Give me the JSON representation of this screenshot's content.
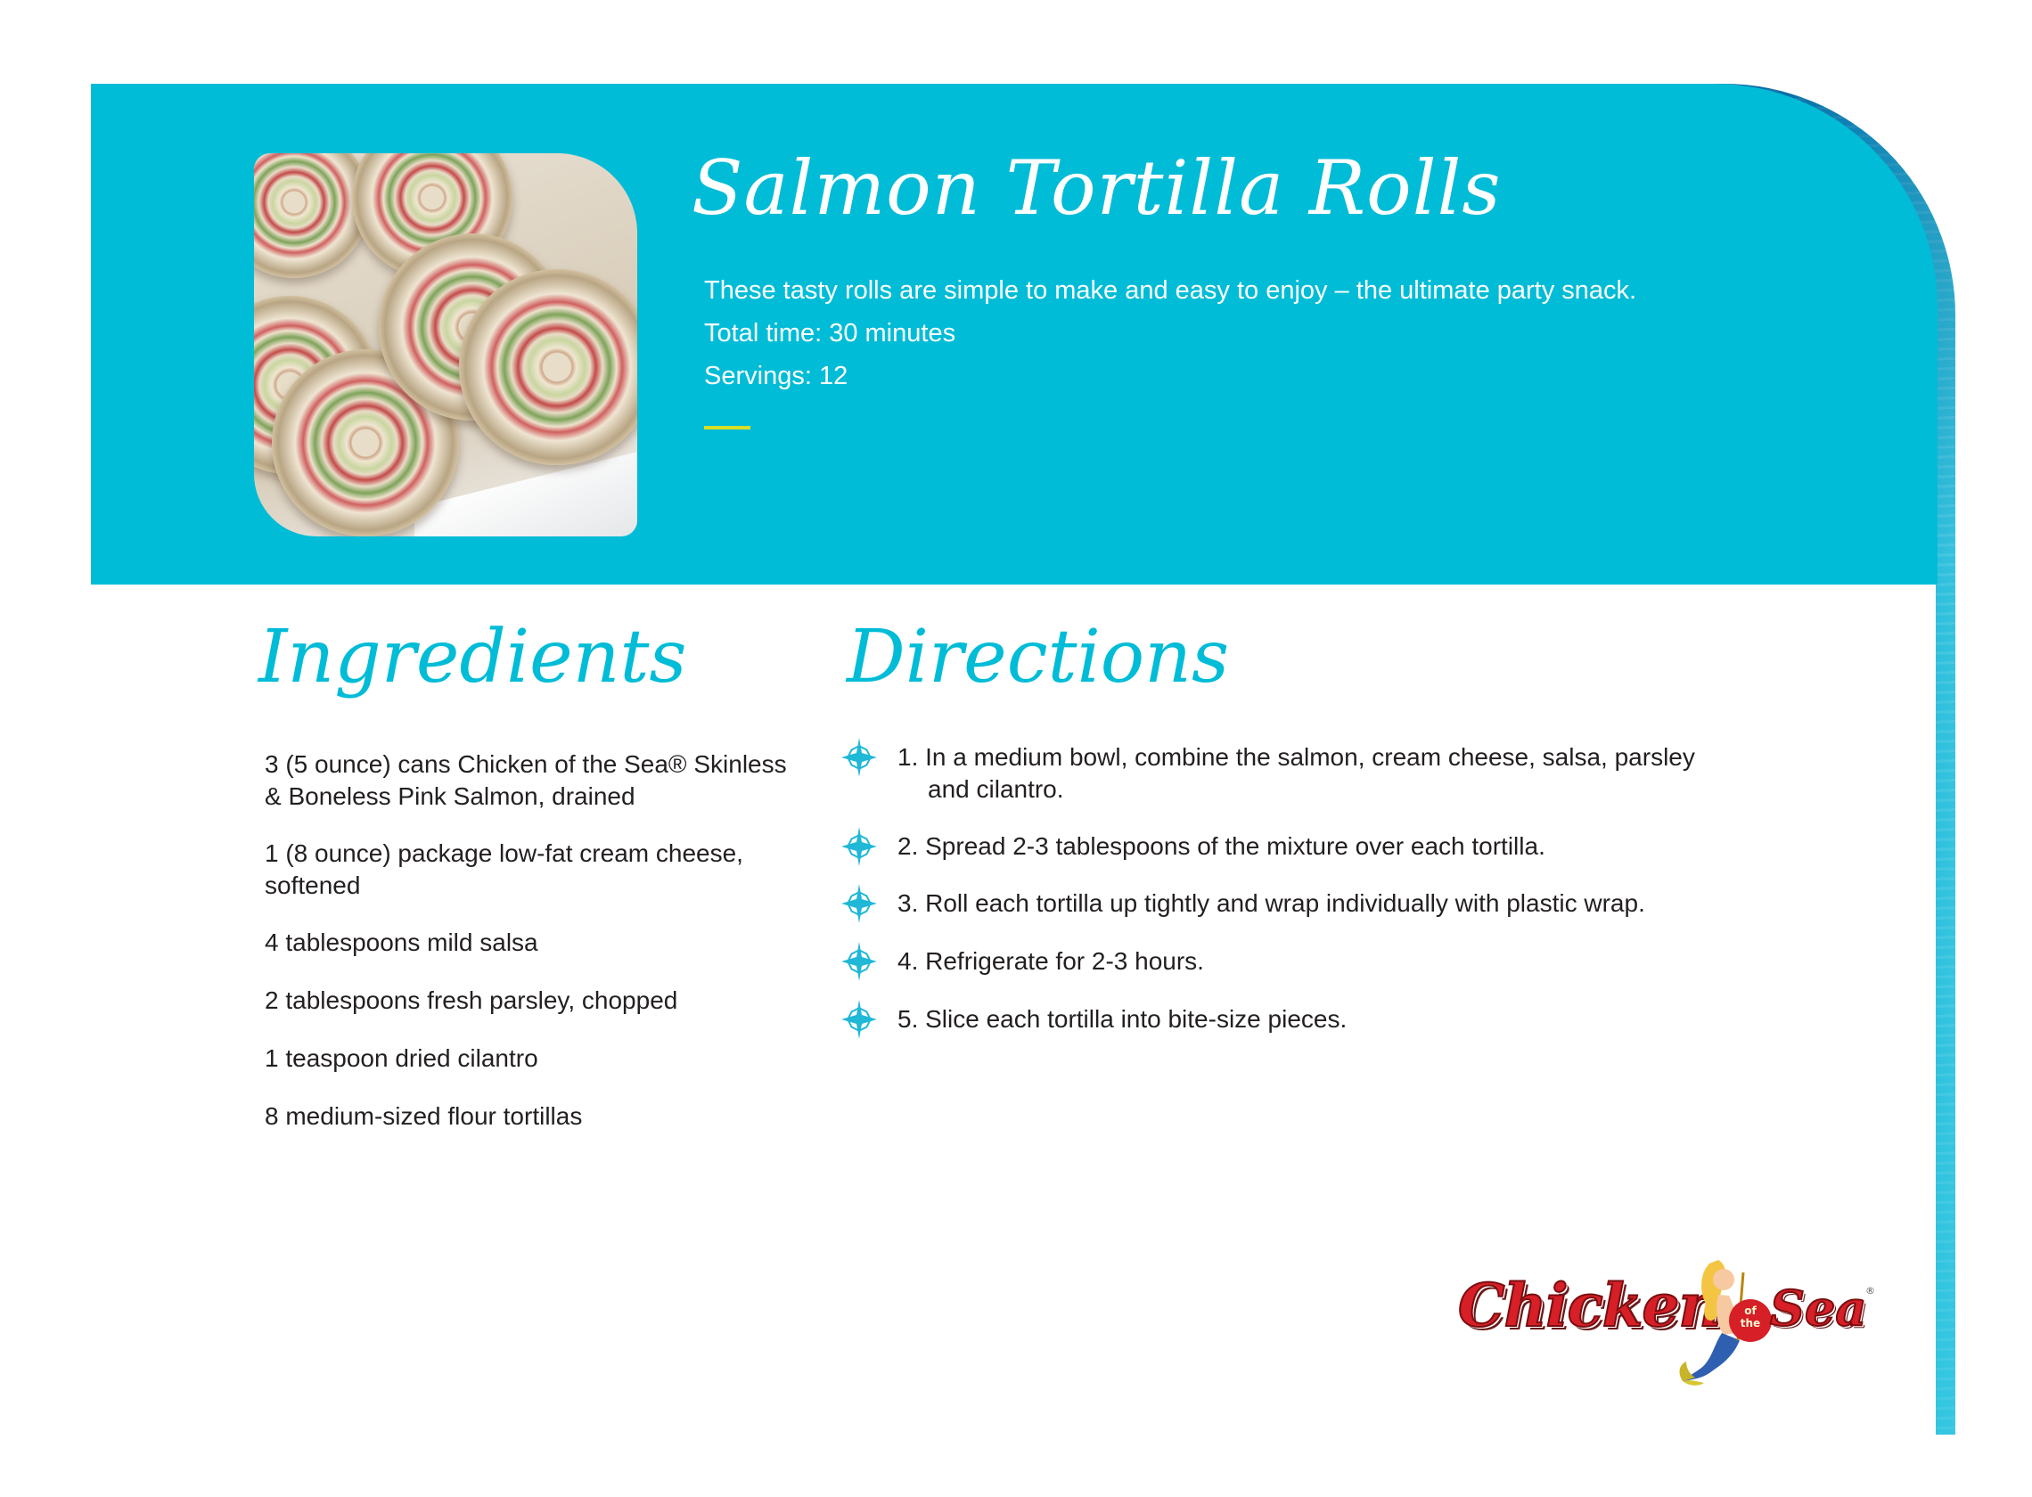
{
  "recipe": {
    "title": "Salmon Tortilla Rolls",
    "description": "These tasty rolls are simple to make and easy to enjoy – the ultimate party snack.",
    "total_time": "Total time: 30 minutes",
    "servings": "Servings: 12"
  },
  "ingredients": {
    "heading": "Ingredients",
    "items": [
      "3 (5 ounce) cans Chicken of the Sea® Skinless & Boneless Pink Salmon, drained",
      "1 (8 ounce) package low-fat cream cheese, softened",
      "4 tablespoons mild salsa",
      "2 tablespoons fresh parsley, chopped",
      "1 teaspoon dried cilantro",
      "8 medium-sized flour tortillas"
    ]
  },
  "directions": {
    "heading": "Directions",
    "steps": [
      {
        "line1": "1. In a medium bowl, combine the salmon, cream cheese, salsa, parsley",
        "line2": "and cilantro."
      },
      {
        "line1": "2. Spread 2-3 tablespoons of the mixture over each tortilla.",
        "line2": ""
      },
      {
        "line1": "3. Roll each tortilla up tightly and wrap individually with plastic wrap.",
        "line2": ""
      },
      {
        "line1": "4. Refrigerate for 2-3 hours.",
        "line2": ""
      },
      {
        "line1": "5. Slice each tortilla into bite-size pieces.",
        "line2": ""
      }
    ]
  },
  "logo": {
    "word_left": "Chicken",
    "word_of": "of",
    "word_the": "the",
    "word_right": "Sea",
    "registered": "®"
  },
  "colors": {
    "header_band": "#00bcd7",
    "heading_script": "#00bcd7",
    "accent_bar": "#d6de23",
    "body_text": "#231f20",
    "logo_red": "#d61f26"
  },
  "icons": {
    "bullet": "sparkle-star-icon",
    "mascot": "mermaid-icon"
  }
}
